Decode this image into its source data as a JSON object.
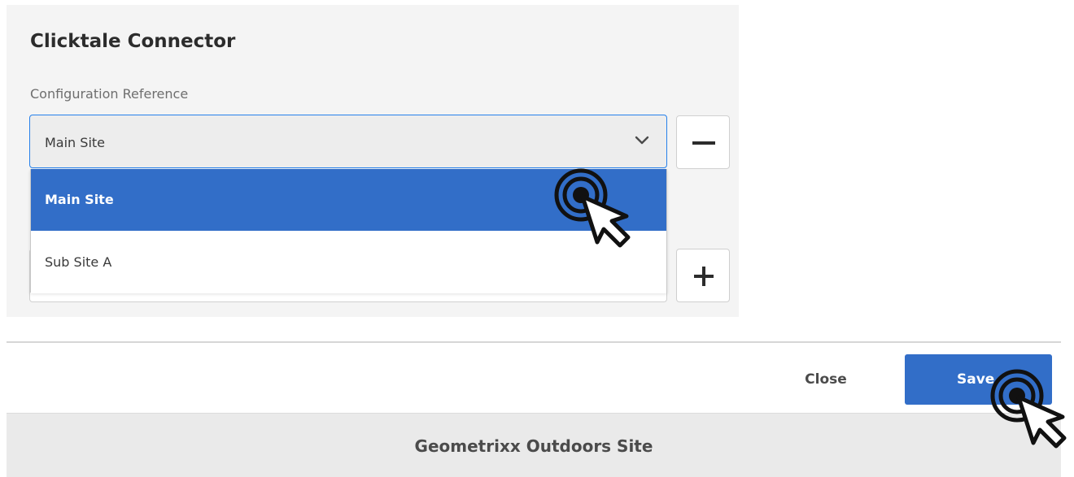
{
  "dialog": {
    "title": "Clicktale Connector",
    "field_label": "Configuration Reference",
    "select": {
      "selected_value": "Main Site",
      "options": [
        "Main Site",
        "Sub Site A"
      ],
      "highlighted_option": "Main Site"
    },
    "remove_icon": "minus-icon",
    "add_icon": "plus-icon"
  },
  "footer": {
    "close_label": "Close",
    "save_label": "Save"
  },
  "bottom_bar": {
    "site_name": "Geometrixx Outdoors Site"
  },
  "colors": {
    "accent": "#326ec8",
    "panel_bg": "#f4f4f4",
    "select_border": "#2680eb"
  },
  "icons": [
    "chevron-down-icon",
    "minus-icon",
    "plus-icon",
    "click-cursor-icon"
  ]
}
